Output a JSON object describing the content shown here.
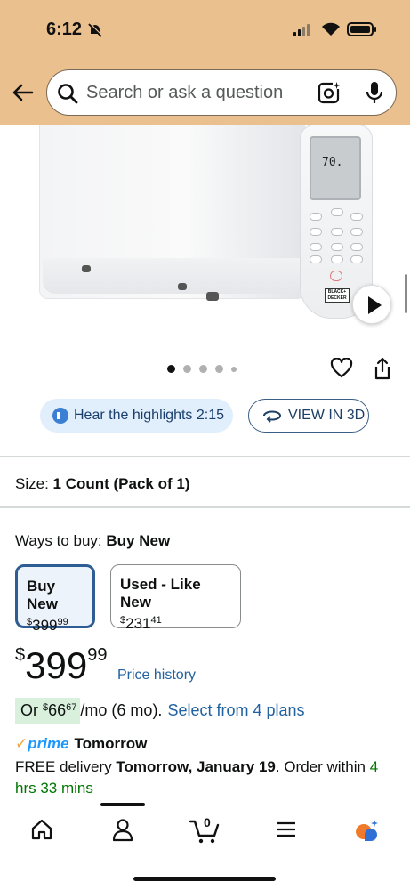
{
  "status_bar": {
    "time": "6:12"
  },
  "search": {
    "placeholder": "Search or ask a question"
  },
  "product_image": {
    "remote_display": "70.",
    "remote_brand": "BLACK+DECKER"
  },
  "actions": {
    "hear_highlights": "Hear the highlights 2:15",
    "view_in_3d": "VIEW IN 3D"
  },
  "size": {
    "label": "Size:",
    "value": "1 Count (Pack of 1)"
  },
  "ways_to_buy": {
    "label": "Ways to buy:",
    "selected": "Buy New",
    "options": [
      {
        "title": "Buy New",
        "currency": "$",
        "whole": "399",
        "cents": "99"
      },
      {
        "title": "Used - Like New",
        "currency": "$",
        "whole": "231",
        "cents": "41"
      }
    ]
  },
  "price": {
    "currency": "$",
    "whole": "399",
    "cents": "99",
    "history_link": "Price history"
  },
  "monthly": {
    "prefix": "Or",
    "currency": "$",
    "whole": "66",
    "cents": "67",
    "suffix": "/mo (6 mo).",
    "link": "Select from 4 plans"
  },
  "delivery": {
    "prime_logo": "prime",
    "prime_when": "Tomorrow",
    "free_delivery": "FREE delivery",
    "date": "Tomorrow, January 19",
    "order_within": ". Order within",
    "countdown": "4 hrs 33 mins"
  },
  "bottom_nav": {
    "cart_count": "0"
  },
  "colors": {
    "header_bg": "#ebc08f",
    "link_blue": "#2162a1",
    "selected_border": "#2e5d94",
    "prime_blue": "#1a98ff",
    "green": "#007600"
  }
}
